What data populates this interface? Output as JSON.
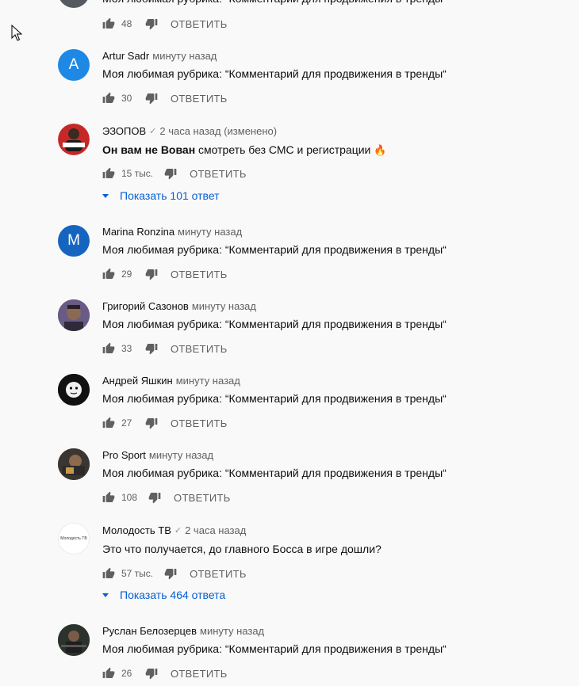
{
  "comments": [
    {
      "author": "",
      "verified": false,
      "time": "",
      "text": "Моя любимая рубрика: “Комментарий для продвижения в тренды“",
      "likes": "48",
      "reply_label": "ОТВЕТИТЬ"
    },
    {
      "author": "Artur Sadr",
      "verified": false,
      "time": "минуту назад",
      "text": "Моя любимая рубрика: “Комментарий для продвижения в тренды“",
      "likes": "30",
      "reply_label": "ОТВЕТИТЬ",
      "avatar_letter": "A",
      "avatar_color": "#1e88e5"
    },
    {
      "author": "ЭЗОПОВ",
      "verified": true,
      "time": "2 часа назад (изменено)",
      "text_bold": "Он вам не Вован",
      "text_rest": " смотреть без СМС и регистрации",
      "emoji": "🔥",
      "likes": "15 тыс.",
      "reply_label": "ОТВЕТИТЬ",
      "replies_label": "Показать 101 ответ",
      "avatar_label": "ЭЗОПОВ",
      "avatar_color": "#c62828"
    },
    {
      "author": "Marina Ronzina",
      "verified": false,
      "time": "минуту назад",
      "text": "Моя любимая рубрика: “Комментарий для продвижения в тренды“",
      "likes": "29",
      "reply_label": "ОТВЕТИТЬ",
      "avatar_letter": "M",
      "avatar_color": "#1565c0"
    },
    {
      "author": "Григорий Сазонов",
      "verified": false,
      "time": "минуту назад",
      "text": "Моя любимая рубрика: “Комментарий для продвижения в тренды“",
      "likes": "33",
      "reply_label": "ОТВЕТИТЬ"
    },
    {
      "author": "Андрей Яшкин",
      "verified": false,
      "time": "минуту назад",
      "text": "Моя любимая рубрика: “Комментарий для продвижения в тренды“",
      "likes": "27",
      "reply_label": "ОТВЕТИТЬ"
    },
    {
      "author": "Pro Sport",
      "verified": false,
      "time": "минуту назад",
      "text": "Моя любимая рубрика: “Комментарий для продвижения в тренды“",
      "likes": "108",
      "reply_label": "ОТВЕТИТЬ"
    },
    {
      "author": "Молодость ТВ",
      "verified": true,
      "time": "2 часа назад",
      "text": "Это что получается, до главного Босса в игре дошли?",
      "likes": "57 тыс.",
      "reply_label": "ОТВЕТИТЬ",
      "replies_label": "Показать 464 ответа",
      "avatar_label": "Молодость ТВ"
    },
    {
      "author": "Руслан Белозерцев",
      "verified": false,
      "time": "минуту назад",
      "text": "Моя любимая рубрика: “Комментарий для продвижения в тренды“",
      "likes": "26",
      "reply_label": "ОТВЕТИТЬ"
    }
  ],
  "icons": {
    "like": "thumb-up-icon",
    "dislike": "thumb-down-icon",
    "verified": "check-icon",
    "expand": "caret-down-icon"
  },
  "colors": {
    "background": "#f9f9f9",
    "link_blue": "#065fd4",
    "secondary_text": "#606060"
  }
}
